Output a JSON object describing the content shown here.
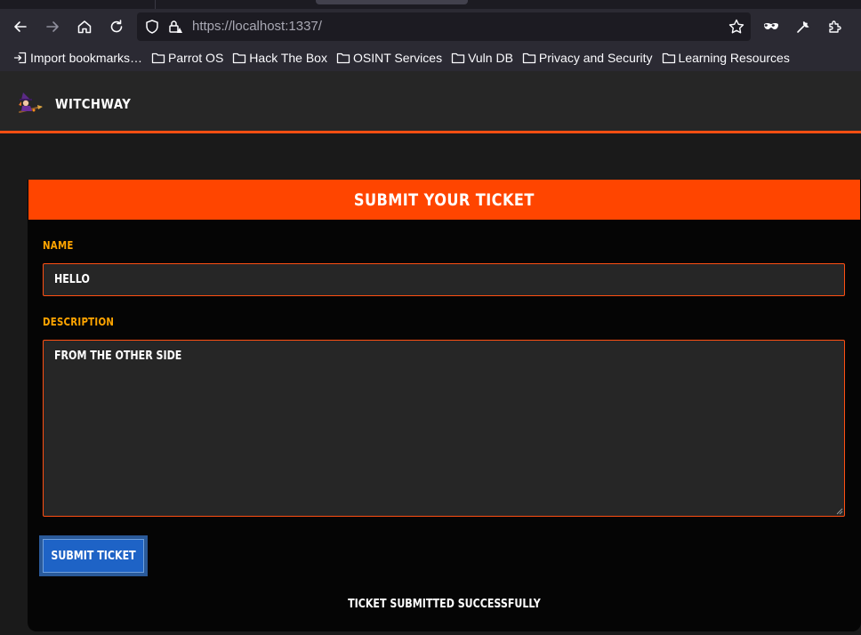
{
  "browser": {
    "url_host": "https://localhost",
    "url_port_path": ":1337/",
    "bookmarks": [
      {
        "label": "Import bookmarks…",
        "icon": "import-icon"
      },
      {
        "label": "Parrot OS",
        "icon": "folder-icon"
      },
      {
        "label": "Hack The Box",
        "icon": "folder-icon"
      },
      {
        "label": "OSINT Services",
        "icon": "folder-icon"
      },
      {
        "label": "Vuln DB",
        "icon": "folder-icon"
      },
      {
        "label": "Privacy and Security",
        "icon": "folder-icon"
      },
      {
        "label": "Learning Resources",
        "icon": "folder-icon"
      }
    ]
  },
  "site": {
    "brand": "Witchway",
    "logo_icon": "witch-on-broom-icon"
  },
  "form": {
    "title": "Submit Your Ticket",
    "name_label": "Name",
    "name_value": "hello",
    "description_label": "Description",
    "description_value": "from the other side",
    "submit_label": "Submit Ticket",
    "status_message": "Ticket submitted successfully"
  },
  "colors": {
    "accent": "#ff4500",
    "label": "#ffa500",
    "button": "#1e63c6"
  }
}
